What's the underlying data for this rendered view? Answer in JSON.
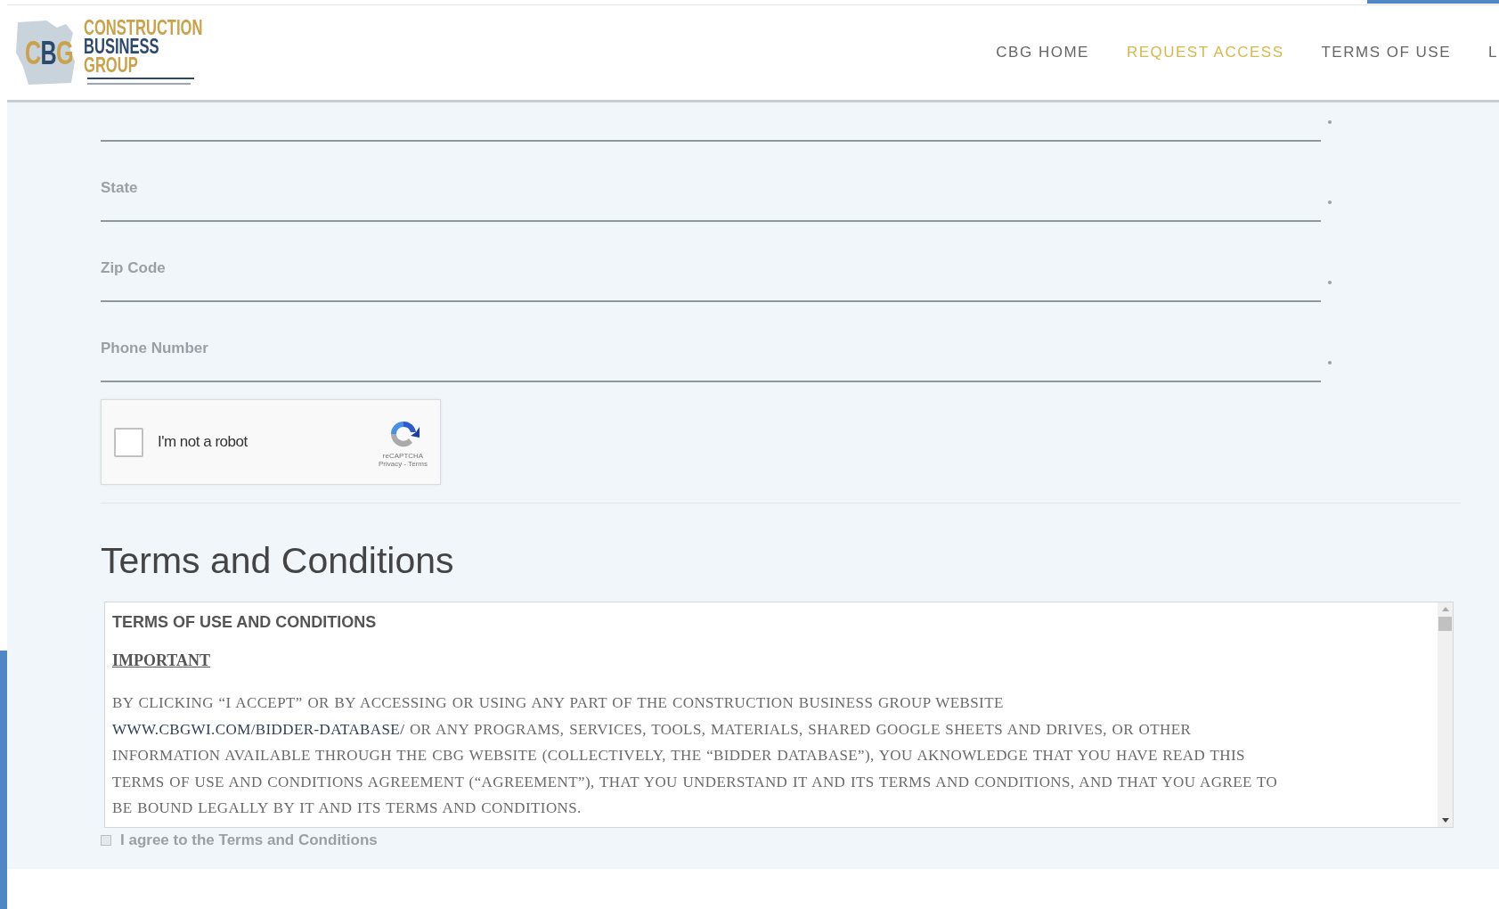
{
  "header": {
    "logo": {
      "letters": [
        {
          "text": "C",
          "color": "#c9a24a"
        },
        {
          "text": "B",
          "color": "#2c4a6e"
        },
        {
          "text": "G",
          "color": "#c9a24a"
        }
      ],
      "lines": [
        {
          "text": "CONSTRUCTION",
          "color": "#c9a24a"
        },
        {
          "text": "BUSINESS",
          "color": "#2c4a6e"
        },
        {
          "text": "GROUP",
          "color": "#c9a24a"
        }
      ]
    },
    "nav": [
      {
        "label": "CBG HOME",
        "selected": false
      },
      {
        "label": "REQUEST ACCESS",
        "selected": true
      },
      {
        "label": "TERMS OF USE",
        "selected": false
      },
      {
        "label": "L",
        "selected": false
      }
    ]
  },
  "form": {
    "fields": [
      {
        "required": true
      },
      {
        "label": "State",
        "required": true
      },
      {
        "label": "Zip Code",
        "required": true
      },
      {
        "label": "Phone Number",
        "required": true
      }
    ],
    "captcha": {
      "label": "I'm not a robot",
      "checked": false,
      "brand": "reCAPTCHA",
      "links": "Privacy - Terms"
    }
  },
  "terms": {
    "heading": "Terms and Conditions",
    "title": "TERMS OF USE AND CONDITIONS",
    "subtitle": "IMPORTANT",
    "paragraph": {
      "before": "BY CLICKING “I ACCEPT” OR BY ACCESSING OR USING ANY PART OF THE CONSTRUCTION BUSINESS GROUP WEBSITE",
      "link": "WWW.CBGWI.COM/BIDDER-DATABASE/",
      "after": "OR ANY PROGRAMS, SERVICES, TOOLS, MATERIALS,  SHARED GOOGLE SHEETS AND DRIVES, OR OTHER INFORMATION AVAILABLE THROUGH THE CBG WEBSITE (COLLECTIVELY, THE “BIDDER DATABASE”), YOU AKNOWLEDGE THAT YOU HAVE READ THIS TERMS OF USE AND CONDITIONS AGREEMENT (“AGREEMENT”), THAT YOU UNDERSTAND IT AND ITS TERMS AND CONDITIONS, AND THAT YOU AGREE TO BE BOUND LEGALLY BY IT AND ITS TERMS AND CONDITIONS."
    },
    "agree": {
      "label": "I agree to the Terms and Conditions",
      "checked": false
    }
  }
}
